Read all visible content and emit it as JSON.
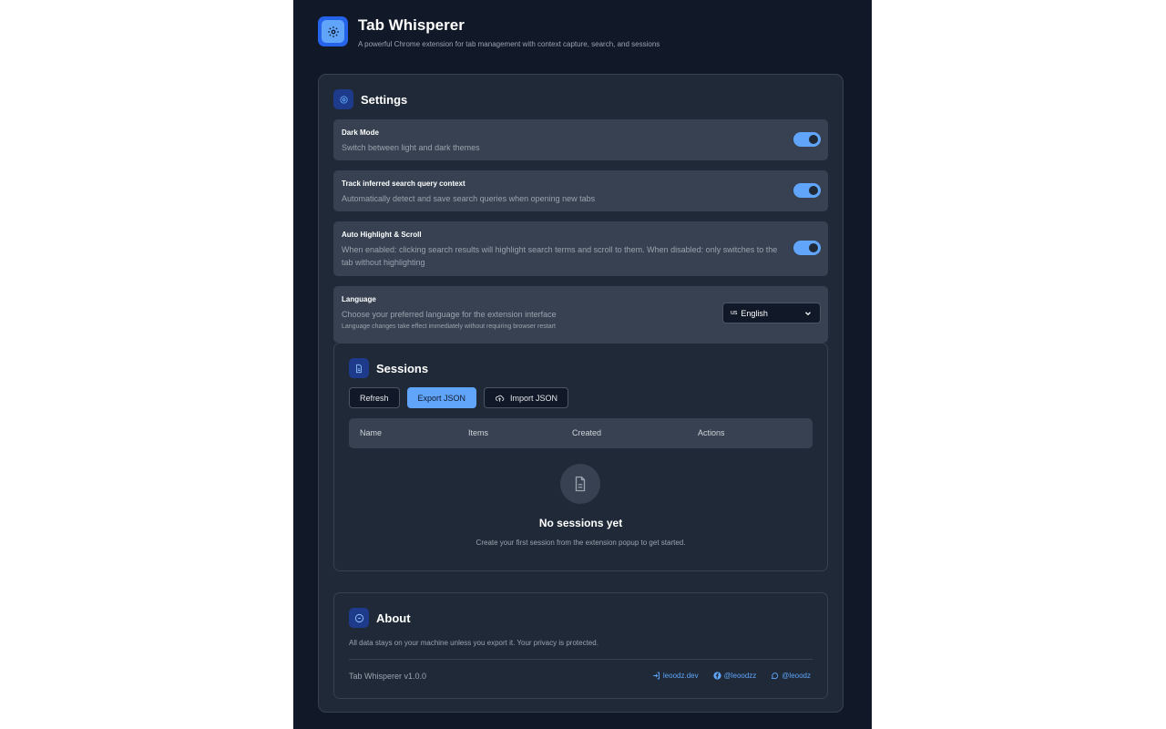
{
  "app": {
    "title": "Tab Whisperer",
    "subtitle": "A powerful Chrome extension for tab management with context capture, search, and sessions"
  },
  "settings": {
    "title": "Settings",
    "dark_mode": {
      "label": "Dark Mode",
      "description": "Switch between light and dark themes",
      "enabled": true
    },
    "track_search": {
      "label": "Track inferred search query context",
      "description": "Automatically detect and save search queries when opening new tabs",
      "enabled": true
    },
    "auto_highlight": {
      "label": "Auto Highlight & Scroll",
      "description": "When enabled: clicking search results will highlight search terms and scroll to them. When disabled: only switches to the tab without highlighting",
      "enabled": true
    },
    "language": {
      "label": "Language",
      "description": "Choose your preferred language for the extension interface",
      "note": "Language changes take effect immediately without requiring browser restart",
      "selected_flag": "us",
      "selected": "English"
    }
  },
  "sessions": {
    "title": "Sessions",
    "buttons": {
      "refresh": "Refresh",
      "export": "Export JSON",
      "import": "Import JSON"
    },
    "columns": [
      "Name",
      "Items",
      "Created",
      "Actions"
    ],
    "empty_title": "No sessions yet",
    "empty_description": "Create your first session from the extension popup to get started."
  },
  "about": {
    "title": "About",
    "text": "All data stays on your machine unless you export it. Your privacy is protected.",
    "version": "Tab Whisperer v1.0.0",
    "links": {
      "website": "leoodz.dev",
      "facebook": "@leoodzz",
      "messenger": "@leoodz"
    }
  },
  "colors": {
    "accent": "#60a5fa",
    "background": "#111827",
    "card": "#1f2937",
    "row": "#374151"
  }
}
